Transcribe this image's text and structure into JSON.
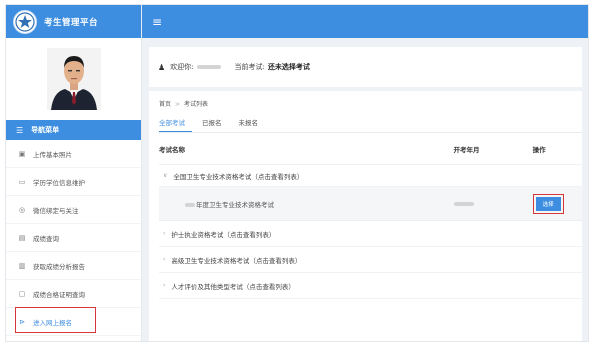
{
  "app": {
    "title": "考生管理平台"
  },
  "sidebar": {
    "nav_header": "导航菜单",
    "items": [
      {
        "label": "上传基本照片",
        "icon": "image-icon"
      },
      {
        "label": "学历学位信息维护",
        "icon": "card-icon"
      },
      {
        "label": "微信绑定与关注",
        "icon": "wechat-icon"
      },
      {
        "label": "成绩查询",
        "icon": "document-icon"
      },
      {
        "label": "获取成绩分析报告",
        "icon": "report-icon"
      },
      {
        "label": "成绩合格证明查询",
        "icon": "certificate-icon"
      },
      {
        "label": "进入网上报名",
        "icon": "enter-icon"
      }
    ]
  },
  "welcome": {
    "greeting": "欢迎你:",
    "current_exam_label": "当前考试:",
    "current_exam_value": "还未选择考试"
  },
  "breadcrumb": {
    "home": "首页",
    "current": "考试列表"
  },
  "tabs": [
    "全部考试",
    "已报名",
    "未报名"
  ],
  "table": {
    "headers": {
      "name": "考试名称",
      "date": "开考年月",
      "action": "操作"
    },
    "groups": [
      "全国卫生专业技术资格考试（点击查看列表）",
      "护士执业资格考试（点击查看列表）",
      "高级卫生专业技术资格考试（点击查看列表）",
      "人才评价及其他类型考试（点击查看列表）"
    ],
    "exam_row": {
      "name": "年度卫生专业技术资格考试",
      "action": "选择"
    }
  },
  "colors": {
    "primary": "#3d8ee0",
    "highlight_red": "#d7363b"
  }
}
